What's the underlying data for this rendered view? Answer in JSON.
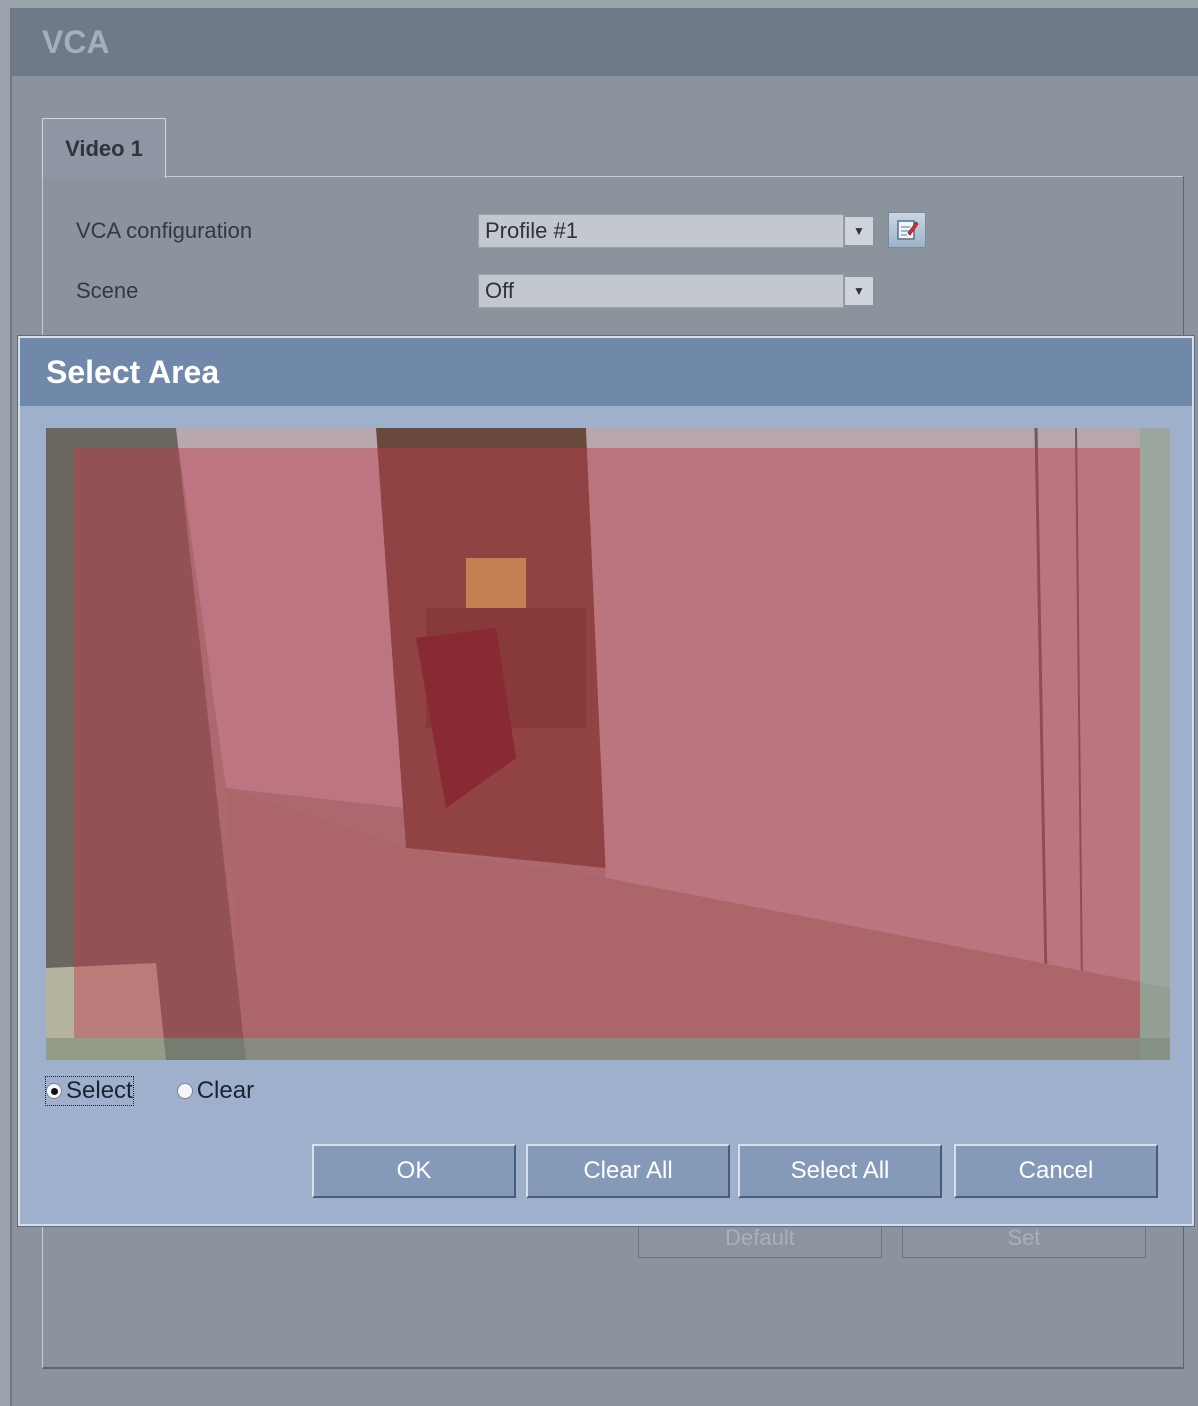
{
  "app": {
    "title": "VCA"
  },
  "tabs": [
    {
      "label": "Video 1"
    }
  ],
  "form": {
    "vca_configuration": {
      "label": "VCA configuration",
      "value": "Profile #1"
    },
    "scene": {
      "label": "Scene",
      "value": "Off"
    }
  },
  "background_buttons": {
    "default": "Default",
    "set": "Set"
  },
  "dialog": {
    "title": "Select Area",
    "mode_options": [
      {
        "label": "Select",
        "checked": true
      },
      {
        "label": "Clear",
        "checked": false
      }
    ],
    "buttons": {
      "ok": "OK",
      "clear_all": "Clear All",
      "select_all": "Select All",
      "cancel": "Cancel"
    },
    "selection_overlay_color": "#c23a4a"
  },
  "icons": {
    "dropdown": "chevron-down-icon",
    "edit": "edit-icon"
  }
}
